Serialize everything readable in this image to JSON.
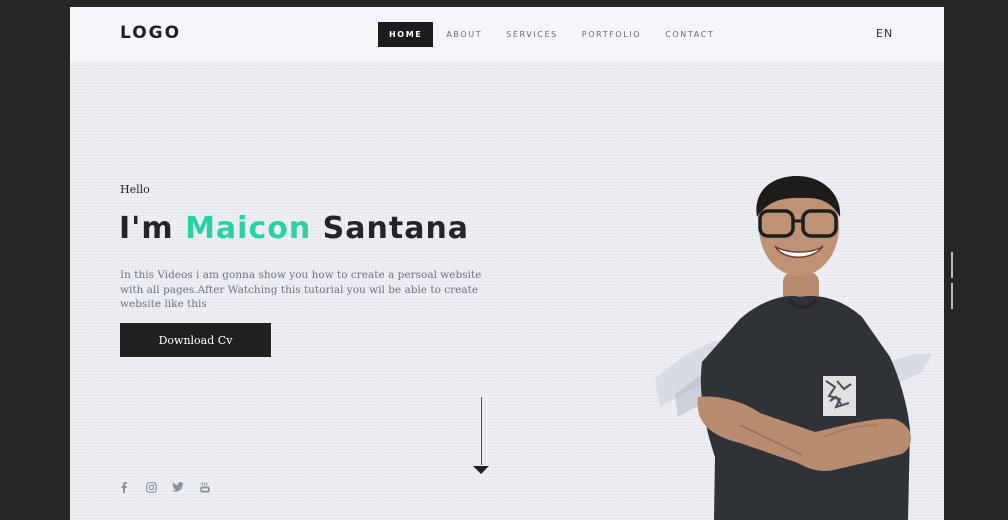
{
  "header": {
    "logo": "LOGO",
    "nav": [
      {
        "label": "HOME",
        "active": true
      },
      {
        "label": "ABOUT",
        "active": false
      },
      {
        "label": "SERVICES",
        "active": false
      },
      {
        "label": "PORTFOLIO",
        "active": false
      },
      {
        "label": "CONTACT",
        "active": false
      }
    ],
    "language": "EN"
  },
  "hero": {
    "greeting": "Hello",
    "headline_prefix": "I'm",
    "headline_accent": "Maicon",
    "headline_suffix": "Santana",
    "intro": "In this Videos i am gonna show you how to create a persoal website with all pages.After Watching this tutorial you wil be able to create website like this",
    "cta_label": "Download Cv",
    "accent_color": "#27d3a6"
  },
  "social": [
    {
      "icon": "facebook-icon"
    },
    {
      "icon": "instagram-icon"
    },
    {
      "icon": "twitter-icon"
    },
    {
      "icon": "youtube-icon"
    }
  ]
}
